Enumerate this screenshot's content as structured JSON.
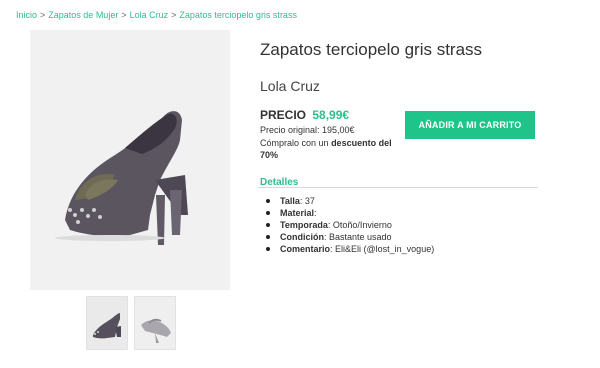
{
  "breadcrumb": {
    "items": [
      "Inicio",
      "Zapatos de Mujer",
      "Lola Cruz",
      "Zapatos terciopelo gris strass"
    ],
    "separator": ">"
  },
  "product": {
    "title": "Zapatos terciopelo gris strass",
    "brand": "Lola Cruz",
    "price_label": "PRECIO",
    "price": "58,99€",
    "original_price": "Precio original: 195,00€",
    "discount_prefix": "Cómpralo con un",
    "discount_bold": "descuento del 70%",
    "cart_button": "AÑADIR A MI CARRITO"
  },
  "details": {
    "title": "Detalles",
    "items": [
      {
        "label": "Talla",
        "value": ": 37"
      },
      {
        "label": "Material",
        "value": ":"
      },
      {
        "label": "Temporada",
        "value": ": Otoño/Invierno"
      },
      {
        "label": "Condición",
        "value": ": Bastante usado"
      },
      {
        "label": "Comentario",
        "value": ": Eli&Eli (@lost_in_vogue)"
      }
    ]
  },
  "colors": {
    "accent": "#2bbf8a",
    "button": "#1fc48a"
  },
  "icons": {
    "shoe_main": "velvet-pump-shoe-image",
    "thumb_1": "shoe-side-thumbnail",
    "thumb_2": "shoe-front-thumbnail"
  }
}
